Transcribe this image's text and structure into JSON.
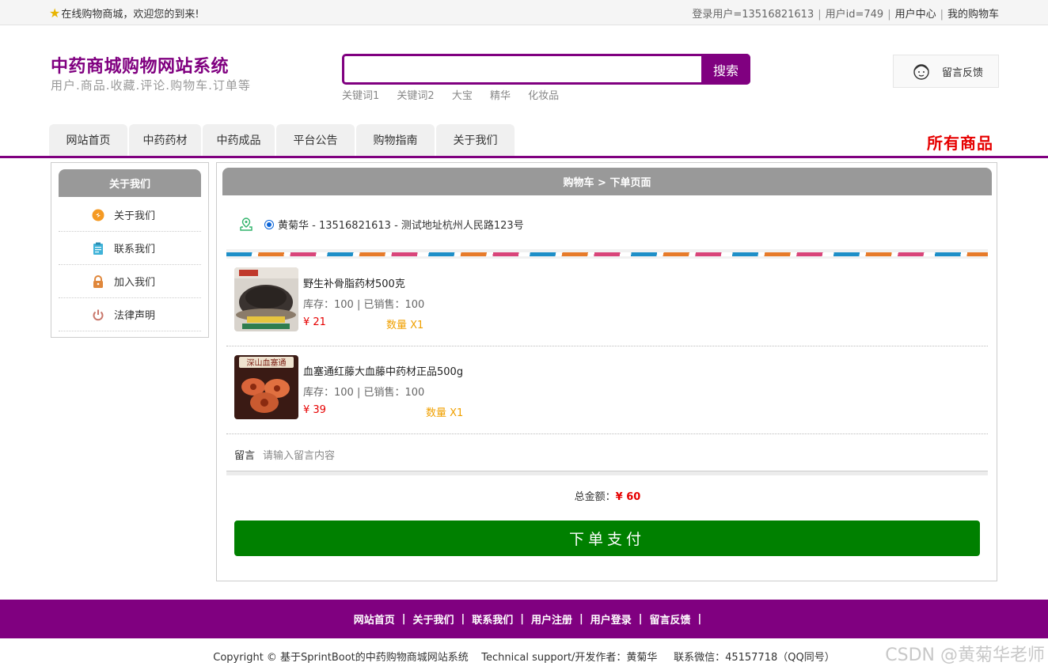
{
  "topbar": {
    "welcome": "在线购物商城，欢迎您的到来!",
    "login_user": "登录用户=13516821613",
    "user_id": "用户id=749",
    "user_center": "用户中心",
    "my_cart": "我的购物车"
  },
  "header": {
    "title": "中药商城购物网站系统",
    "subtitle": "用户.商品.收藏.评论.购物车.订单等",
    "search_placeholder": "",
    "search_button": "搜索",
    "keywords": [
      "关键词1",
      "关键词2",
      "大宝",
      "精华",
      "化妆品"
    ],
    "feedback": "留言反馈"
  },
  "nav": {
    "tabs": [
      "网站首页",
      "中药药材",
      "中药成品",
      "平台公告",
      "购物指南",
      "关于我们"
    ],
    "all_goods": "所有商品"
  },
  "sidebar": {
    "title": "关于我们",
    "items": [
      {
        "label": "关于我们",
        "icon": "about-icon",
        "color": "#f59a23"
      },
      {
        "label": "联系我们",
        "icon": "clipboard-icon",
        "color": "#3fb2d8"
      },
      {
        "label": "加入我们",
        "icon": "lock-icon",
        "color": "#e0873b"
      },
      {
        "label": "法律声明",
        "icon": "power-icon",
        "color": "#c9776b"
      }
    ]
  },
  "main": {
    "breadcrumb": "购物车 > 下单页面",
    "address": "黄菊华 - 13516821613 - 测试地址杭州人民路123号",
    "products": [
      {
        "name": "野生补骨脂药材500克",
        "stock": "库存：100 | 已销售：100",
        "price": "¥ 21",
        "qty": "数量 X1"
      },
      {
        "name": "血塞通红藤大血藤中药材正品500g",
        "stock": "库存：100 | 已销售：100",
        "price": "¥ 39",
        "qty": "数量 X1"
      }
    ],
    "remark_label": "留言",
    "remark_placeholder": "请输入留言内容",
    "total_label": "总金额：",
    "total_amount": "¥ 60",
    "pay_button": "下单支付"
  },
  "footer": {
    "links": [
      "网站首页",
      "关于我们",
      "联系我们",
      "用户注册",
      "用户登录",
      "留言反馈"
    ],
    "copyright": "Copyright © 基于SprintBoot的中药购物商城网站系统    Technical support/开发作者：黄菊华     联系微信：45157718（QQ同号）",
    "watermark": "CSDN @黄菊华老师"
  },
  "colors": {
    "brand": "#800080",
    "price": "#e60000",
    "pay": "#008000",
    "qty": "#f0a000"
  }
}
